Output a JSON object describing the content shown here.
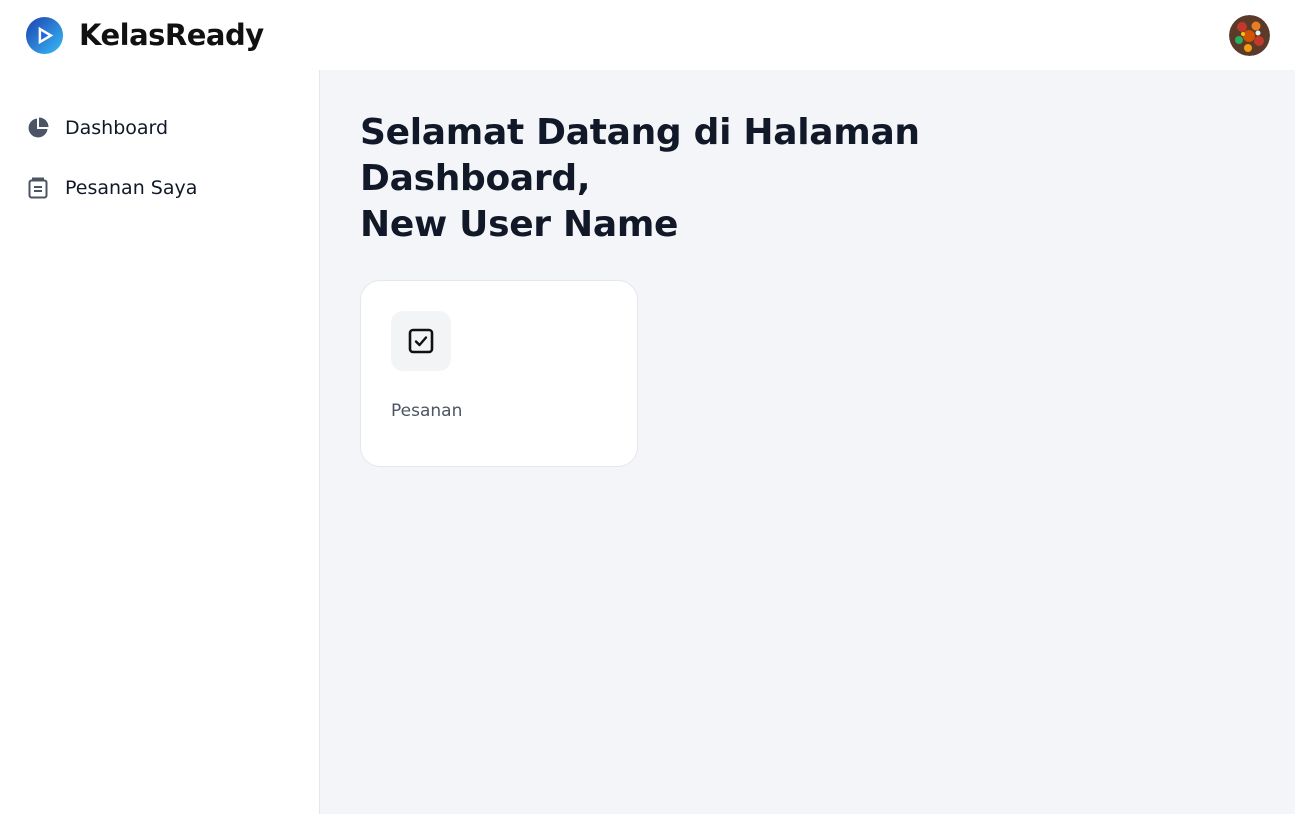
{
  "app": {
    "brand_name": "KelasReady",
    "brand_color": "#2563eb",
    "logo_icon": "play-circle-icon",
    "avatar_icon": "user-avatar"
  },
  "sidebar": {
    "items": [
      {
        "label": "Dashboard",
        "icon": "pie-chart-icon",
        "active": true
      },
      {
        "label": "Pesanan Saya",
        "icon": "order-list-icon",
        "active": false
      }
    ]
  },
  "main": {
    "title_line1": "Selamat Datang di Halaman Dashboard,",
    "title_line2": "New User Name",
    "cards": [
      {
        "label": "Pesanan",
        "icon": "checkbox-icon"
      }
    ]
  },
  "colors": {
    "background": "#f4f5f9",
    "text_primary": "#111827",
    "text_secondary": "#4b5563",
    "border": "#e5e7eb"
  }
}
